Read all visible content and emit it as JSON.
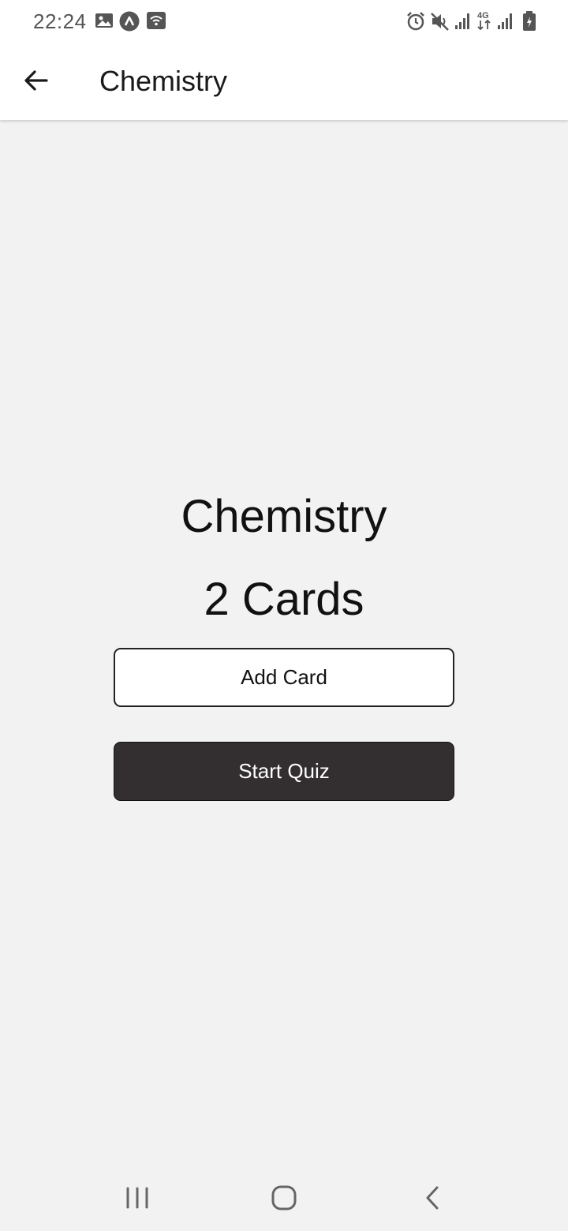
{
  "status_bar": {
    "time": "22:24",
    "left_icons": [
      "image-icon",
      "app-a-icon",
      "wifi-call-icon"
    ],
    "right_icons": [
      "alarm-icon",
      "mute-icon",
      "signal-icon",
      "4g-data-icon",
      "signal-2-icon",
      "battery-charging-icon"
    ],
    "network_label": "4G"
  },
  "app_bar": {
    "back_icon": "arrow-left-icon",
    "title": "Chemistry"
  },
  "deck": {
    "title": "Chemistry",
    "card_count": "2 Cards",
    "add_card_label": "Add Card",
    "start_quiz_label": "Start Quiz"
  },
  "nav_bar": {
    "items": [
      "recents-icon",
      "home-icon",
      "back-icon"
    ]
  },
  "colors": {
    "background": "#f2f2f2",
    "app_bar": "#ffffff",
    "dark_button": "#332f30",
    "text": "#111111"
  }
}
